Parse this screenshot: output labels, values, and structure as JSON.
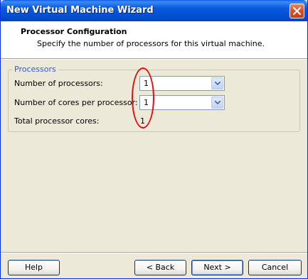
{
  "window": {
    "title": "New Virtual Machine Wizard",
    "close_icon": "close-icon"
  },
  "header": {
    "title": "Processor Configuration",
    "subtitle": "Specify the number of processors for this virtual machine."
  },
  "processors_group": {
    "legend": "Processors",
    "number_of_processors_label": "Number of processors:",
    "number_of_processors_value": "1",
    "cores_per_processor_label": "Number of cores per processor:",
    "cores_per_processor_value": "1",
    "total_cores_label": "Total processor cores:",
    "total_cores_value": "1"
  },
  "annotation": {
    "color": "#e01010",
    "shape": "ellipse"
  },
  "buttons": {
    "help": "Help",
    "back": "< Back",
    "next": "Next >",
    "cancel": "Cancel"
  },
  "colors": {
    "titlebar": "#0450d6",
    "dialog_bg": "#ece9d8",
    "legend_text": "#2f5fce"
  }
}
